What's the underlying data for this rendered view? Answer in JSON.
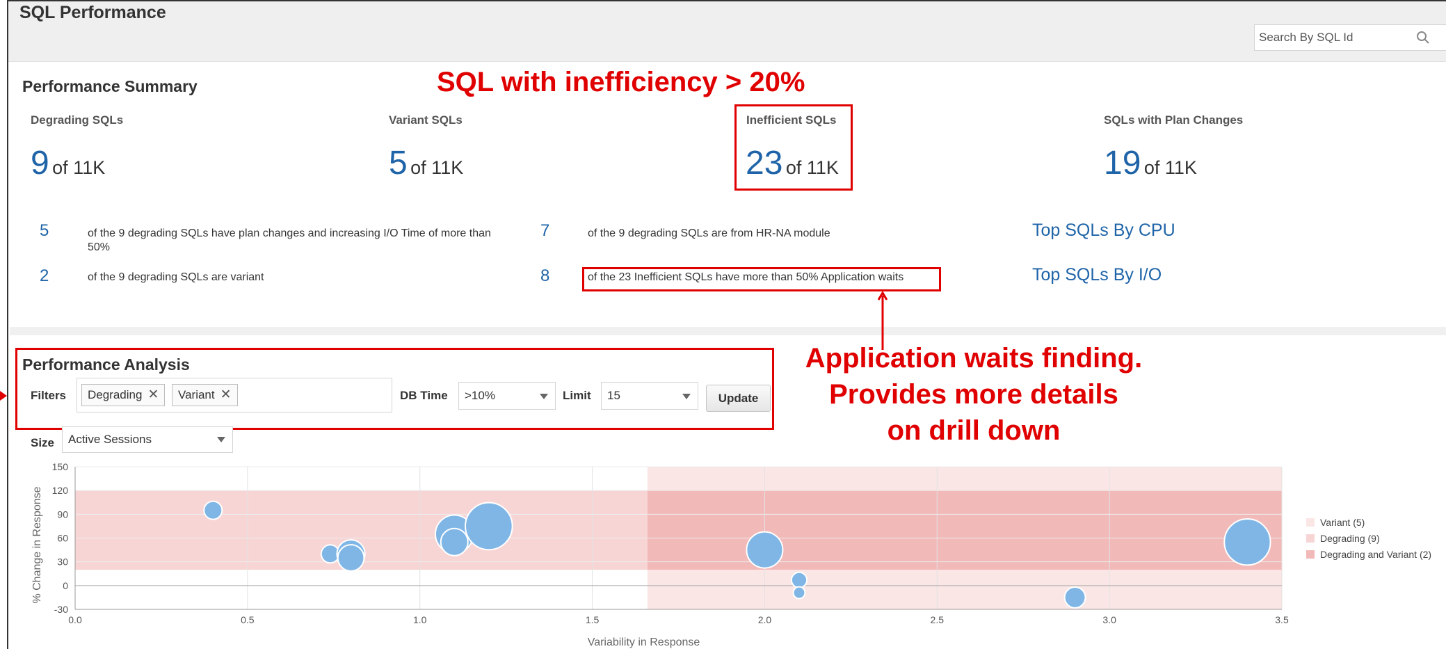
{
  "page": {
    "title": "SQL Performance"
  },
  "search": {
    "placeholder": "Search By SQL Id"
  },
  "summary": {
    "title": "Performance Summary",
    "metrics": [
      {
        "label": "Degrading SQLs",
        "value": "9",
        "of": "of 11K"
      },
      {
        "label": "Variant SQLs",
        "value": "5",
        "of": "of 11K"
      },
      {
        "label": "Inefficient SQLs",
        "value": "23",
        "of": "of 11K"
      },
      {
        "label": "SQLs with Plan Changes",
        "value": "19",
        "of": "of 11K"
      }
    ],
    "findings": [
      {
        "num": "5",
        "text": "of the 9 degrading SQLs have plan changes and increasing I/O Time of more than 50%"
      },
      {
        "num": "2",
        "text": "of the 9 degrading SQLs are variant"
      },
      {
        "num": "7",
        "text": "of the 9 degrading SQLs are from HR-NA module"
      },
      {
        "num": "8",
        "text": "of the 23 Inefficient SQLs have more than 50% Application waits"
      }
    ],
    "links": [
      "Top SQLs By CPU",
      "Top SQLs By I/O"
    ]
  },
  "annotations": {
    "inefficiency": "SQL with inefficiency > 20%",
    "app_waits_1": "Application waits finding.",
    "app_waits_2": "Provides more details",
    "app_waits_3": "on drill down"
  },
  "analysis": {
    "title": "Performance Analysis",
    "filters_label": "Filters",
    "tags": [
      "Degrading",
      "Variant"
    ],
    "db_time_label": "DB Time",
    "db_time_value": ">10%",
    "limit_label": "Limit",
    "limit_value": "15",
    "update_label": "Update",
    "size_label": "Size",
    "size_value": "Active Sessions"
  },
  "colors": {
    "accent": "#1f64a8",
    "annotation": "#e00000",
    "bubble": "#7fb6e6"
  },
  "chart_data": {
    "type": "scatter",
    "xlabel": "Variability in Response",
    "ylabel": "% Change in Response",
    "xlim": [
      0.0,
      3.5
    ],
    "ylim": [
      -30,
      150
    ],
    "xticks": [
      "0.0",
      "0.5",
      "1.0",
      "1.5",
      "2.0",
      "2.5",
      "3.0",
      "3.5"
    ],
    "yticks": [
      "150",
      "120",
      "90",
      "60",
      "30",
      "0",
      "-30"
    ],
    "bands": [
      {
        "name": "Variant (5)",
        "color": "#fbe6e6",
        "x": [
          1.66,
          3.5
        ],
        "y": [
          -30,
          150
        ]
      },
      {
        "name": "Degrading (9)",
        "color": "#f8d5d5",
        "x": [
          0.0,
          3.5
        ],
        "y": [
          20,
          120
        ]
      },
      {
        "name": "Degrading and Variant (2)",
        "color": "#f2b9b9",
        "x": [
          1.66,
          3.5
        ],
        "y": [
          20,
          120
        ]
      }
    ],
    "points": [
      {
        "x": 0.4,
        "y": 95,
        "size": 1.0
      },
      {
        "x": 0.74,
        "y": 40,
        "size": 1.0
      },
      {
        "x": 0.8,
        "y": 40,
        "size": 1.55
      },
      {
        "x": 0.8,
        "y": 35,
        "size": 1.45
      },
      {
        "x": 1.1,
        "y": 65,
        "size": 2.1
      },
      {
        "x": 1.1,
        "y": 55,
        "size": 1.5
      },
      {
        "x": 1.2,
        "y": 75,
        "size": 2.6
      },
      {
        "x": 2.0,
        "y": 45,
        "size": 2.0
      },
      {
        "x": 2.1,
        "y": 7,
        "size": 0.85
      },
      {
        "x": 2.1,
        "y": -9,
        "size": 0.65
      },
      {
        "x": 2.9,
        "y": -15,
        "size": 1.15
      },
      {
        "x": 3.4,
        "y": 55,
        "size": 2.55
      }
    ],
    "legend": [
      "Variant (5)",
      "Degrading (9)",
      "Degrading and Variant (2)"
    ],
    "legend_position": "right"
  }
}
